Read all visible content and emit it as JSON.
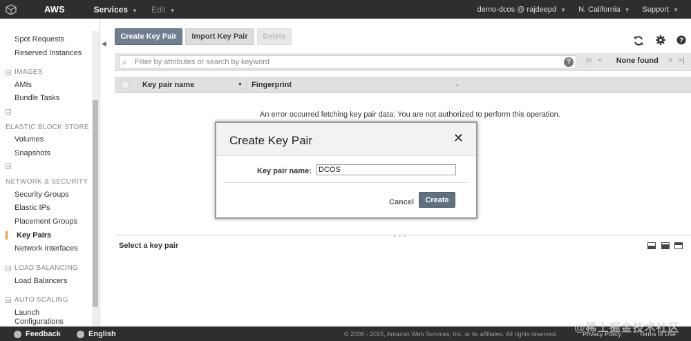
{
  "topnav": {
    "brand": "AWS",
    "services": "Services",
    "edit": "Edit",
    "account": "demo-dcos @ rajdeepd",
    "region": "N. California",
    "support": "Support"
  },
  "sidebar": {
    "items": [
      {
        "label": "Spot Requests"
      },
      {
        "label": "Reserved Instances"
      },
      {
        "label": "AMIs"
      },
      {
        "label": "Bundle Tasks"
      },
      {
        "label": "Volumes"
      },
      {
        "label": "Snapshots"
      },
      {
        "label": "Security Groups"
      },
      {
        "label": "Elastic IPs"
      },
      {
        "label": "Placement Groups"
      },
      {
        "label": "Key Pairs"
      },
      {
        "label": "Network Interfaces"
      },
      {
        "label": "Load Balancers"
      },
      {
        "label": "Launch Configurations"
      }
    ],
    "sections": [
      {
        "label": "IMAGES"
      },
      {
        "label": "ELASTIC BLOCK STORE"
      },
      {
        "label": "NETWORK & SECURITY"
      },
      {
        "label": "LOAD BALANCING"
      },
      {
        "label": "AUTO SCALING"
      }
    ],
    "active_item": "Key Pairs"
  },
  "toolbar": {
    "create_label": "Create Key Pair",
    "import_label": "Import Key Pair",
    "delete_label": "Delete"
  },
  "filter": {
    "placeholder": "Filter by attributes or search by keyword",
    "pager_label": "None found"
  },
  "table": {
    "columns": [
      "Key pair name",
      "Fingerprint"
    ],
    "fingerprint_dash": "-",
    "error": "An error occurred fetching key pair data: You are not authorized to perform this operation."
  },
  "detail": {
    "title": "Select a key pair"
  },
  "modal": {
    "title": "Create Key Pair",
    "close": "✕",
    "field_label": "Key pair name:",
    "field_value": "DCOS",
    "cancel_label": "Cancel",
    "create_label": "Create"
  },
  "footer": {
    "feedback": "Feedback",
    "language": "English",
    "copyright": "© 2008 - 2015, Amazon Web Services, Inc. or its affiliates. All rights reserved.",
    "privacy": "Privacy Policy",
    "terms": "Terms of Use"
  },
  "watermark": "@稀土掘金技术社区",
  "colors": {
    "nav_bg": "#2e2e2e",
    "primary_button": "#6f7f90",
    "active_marker": "#f0a030"
  }
}
